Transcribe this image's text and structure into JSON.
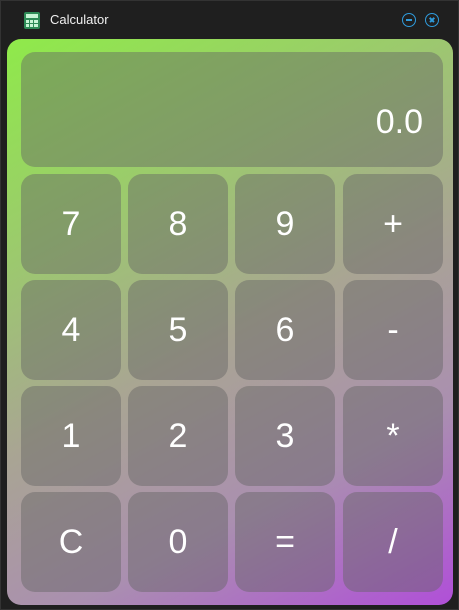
{
  "window": {
    "title": "Calculator",
    "icon": "calculator-icon",
    "minimize_icon": "minimize-icon",
    "close_icon": "close-icon",
    "accent": "#2f9bdc"
  },
  "display": {
    "value": "0.0"
  },
  "keys": {
    "row1": [
      "7",
      "8",
      "9",
      "+"
    ],
    "row2": [
      "4",
      "5",
      "6",
      "-"
    ],
    "row3": [
      "1",
      "2",
      "3",
      "*"
    ],
    "row4": [
      "C",
      "0",
      "=",
      "/"
    ]
  },
  "colors": {
    "gradient_start": "#8fea4a",
    "gradient_end": "#b04fd8",
    "key_text": "#ffffff"
  }
}
